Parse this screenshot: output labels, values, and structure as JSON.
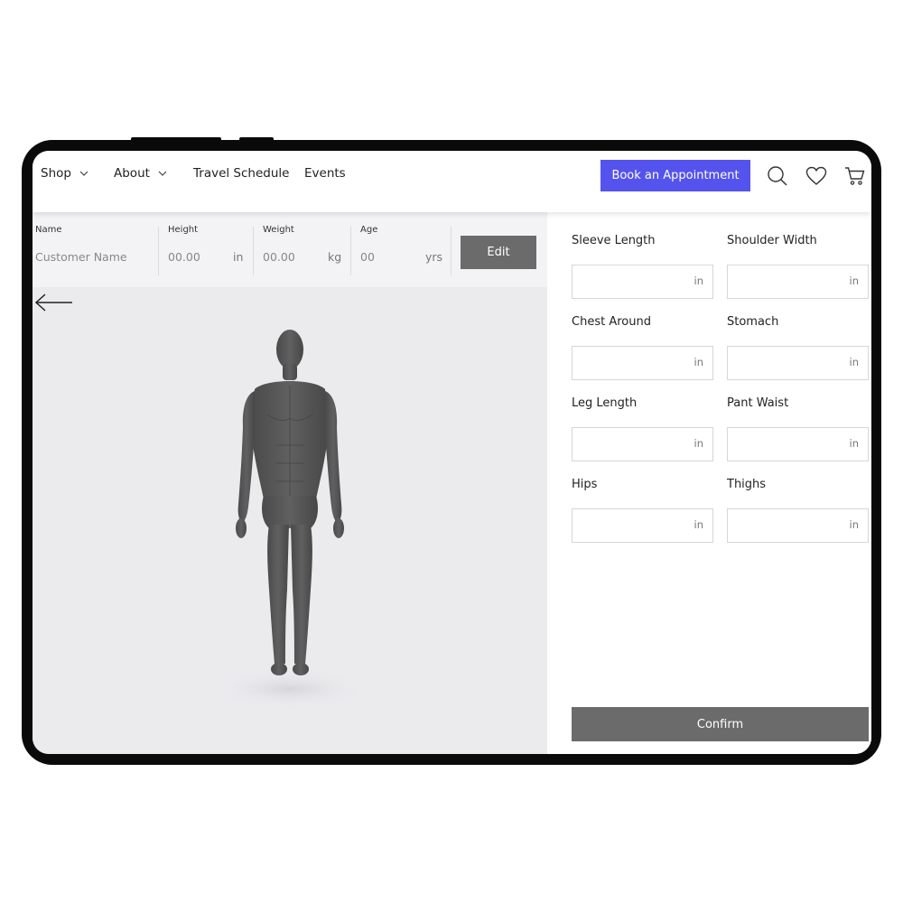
{
  "nav": {
    "items": [
      {
        "label": "Shop",
        "has_dropdown": true
      },
      {
        "label": "About",
        "has_dropdown": true
      },
      {
        "label": "Travel Schedule",
        "has_dropdown": false
      },
      {
        "label": "Events",
        "has_dropdown": false
      }
    ],
    "cta_label": "Book an Appointment",
    "cta_color": "#5553ee",
    "icons": [
      "search-icon",
      "heart-icon",
      "cart-icon"
    ]
  },
  "customer": {
    "name_label": "Name",
    "name_placeholder": "Customer Name",
    "height_label": "Height",
    "height_value": "00.00",
    "height_unit": "in",
    "weight_label": "Weight",
    "weight_value": "00.00",
    "weight_unit": "kg",
    "age_label": "Age",
    "age_value": "00",
    "age_unit": "yrs",
    "edit_label": "Edit"
  },
  "measurements": [
    {
      "label": "Sleeve Length",
      "unit": "in"
    },
    {
      "label": "Shoulder Width",
      "unit": "in"
    },
    {
      "label": "Chest Around",
      "unit": "in"
    },
    {
      "label": "Stomach",
      "unit": "in"
    },
    {
      "label": "Leg Length",
      "unit": "in"
    },
    {
      "label": "Pant Waist",
      "unit": "in"
    },
    {
      "label": "Hips",
      "unit": "in"
    },
    {
      "label": "Thighs",
      "unit": "in"
    }
  ],
  "confirm_label": "Confirm",
  "model_color": "#555555"
}
